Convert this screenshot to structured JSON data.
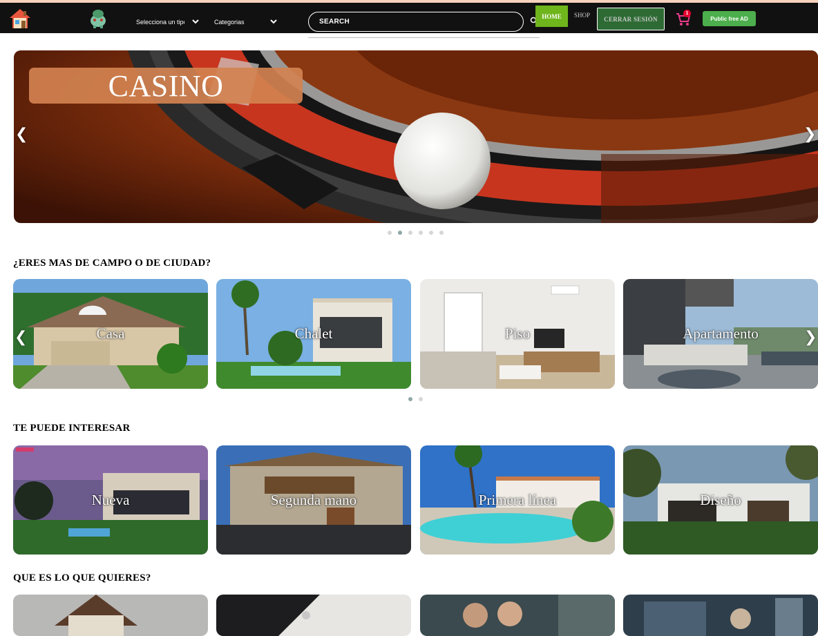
{
  "navbar": {
    "home_label": "HOME",
    "shop_label": "SHOP",
    "logout_label": "CERRAR SESIÓN",
    "publish_label": "Public free AD",
    "cart_count": "1",
    "type_select_value": "Selecciona un tipo",
    "category_select_value": "Categorias",
    "search_placeholder": "SEARCH",
    "accent_color": "#6fb51c"
  },
  "hero": {
    "title": "CASINO",
    "prev_arrow": "❮",
    "next_arrow": "❯",
    "slide_count": 6,
    "active_slide": 2
  },
  "section1": {
    "title": "¿ERES MAS DE CAMPO O DE CIUDAD?",
    "cards": [
      {
        "label": "Casa"
      },
      {
        "label": "Chalet"
      },
      {
        "label": "Piso"
      },
      {
        "label": "Apartamento"
      }
    ],
    "prev_arrow": "❮",
    "next_arrow": "❯"
  },
  "section2": {
    "title": "TE PUEDE INTERESAR",
    "cards": [
      {
        "label": "Nueva"
      },
      {
        "label": "Segunda mano"
      },
      {
        "label": "Primera línea"
      },
      {
        "label": "Diseño"
      }
    ]
  },
  "section3": {
    "title": "QUE ES LO QUE QUIERES?"
  }
}
